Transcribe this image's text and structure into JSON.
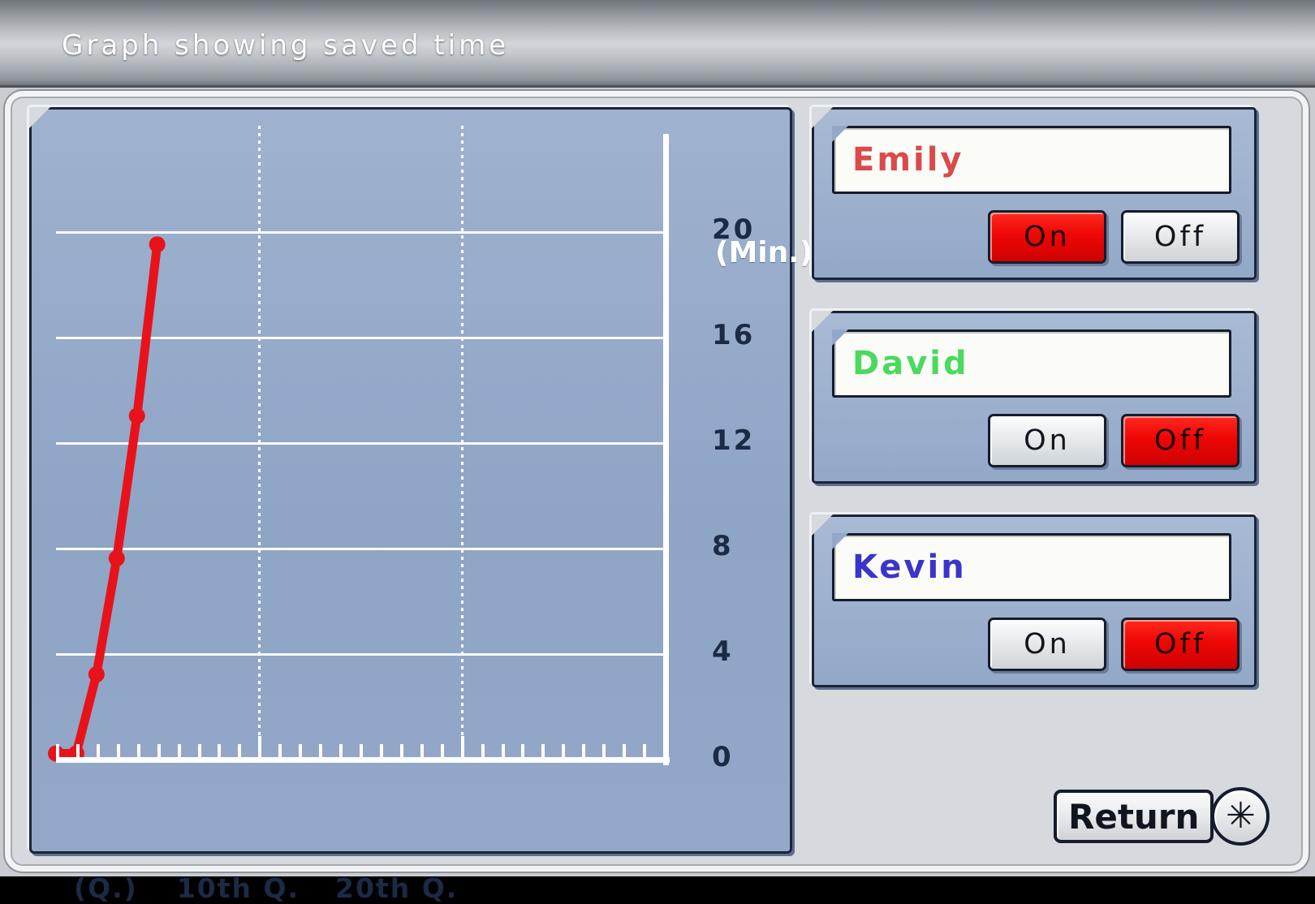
{
  "window": {
    "title": "Graph showing saved time"
  },
  "chart_data": {
    "type": "line",
    "title": "Graph showing saved time",
    "xlabel": "(Q.)",
    "ylabel": "(Min.)",
    "x_unit_label": "(Q.)",
    "y_unit_label": "(Min.)",
    "y_ticks": [
      20,
      16,
      12,
      8,
      4,
      0
    ],
    "ylim": [
      0,
      24
    ],
    "xlim": [
      0,
      30
    ],
    "x_tick_labels": [
      "10th Q.",
      "20th Q."
    ],
    "x_tick_count": 30,
    "x_major_ticks": [
      10,
      20
    ],
    "grid": "horizontal-solid-vertical-dotted",
    "legend": "none",
    "series": [
      {
        "name": "saved time",
        "color": "#e8131a",
        "x": [
          0,
          1,
          2,
          3,
          4,
          5
        ],
        "values": [
          0.2,
          0.2,
          3.2,
          7.6,
          13.0,
          19.5
        ]
      }
    ]
  },
  "people": [
    {
      "name": "Emily",
      "name_color": "#d94b4b",
      "on_label": "On",
      "off_label": "Off",
      "state": "On"
    },
    {
      "name": "David",
      "name_color": "#4bd95e",
      "on_label": "On",
      "off_label": "Off",
      "state": "Off"
    },
    {
      "name": "Kevin",
      "name_color": "#3a35c9",
      "on_label": "On",
      "off_label": "Off",
      "state": "Off"
    }
  ],
  "footer": {
    "return_label": "Return",
    "star_glyph": "✳"
  },
  "colors": {
    "accent_red": "#ee0606",
    "plot_bg": "#93a8c8",
    "grid_white": "#ffffff",
    "axis_text": "#1b2a45",
    "frame": "#d6d9de"
  }
}
